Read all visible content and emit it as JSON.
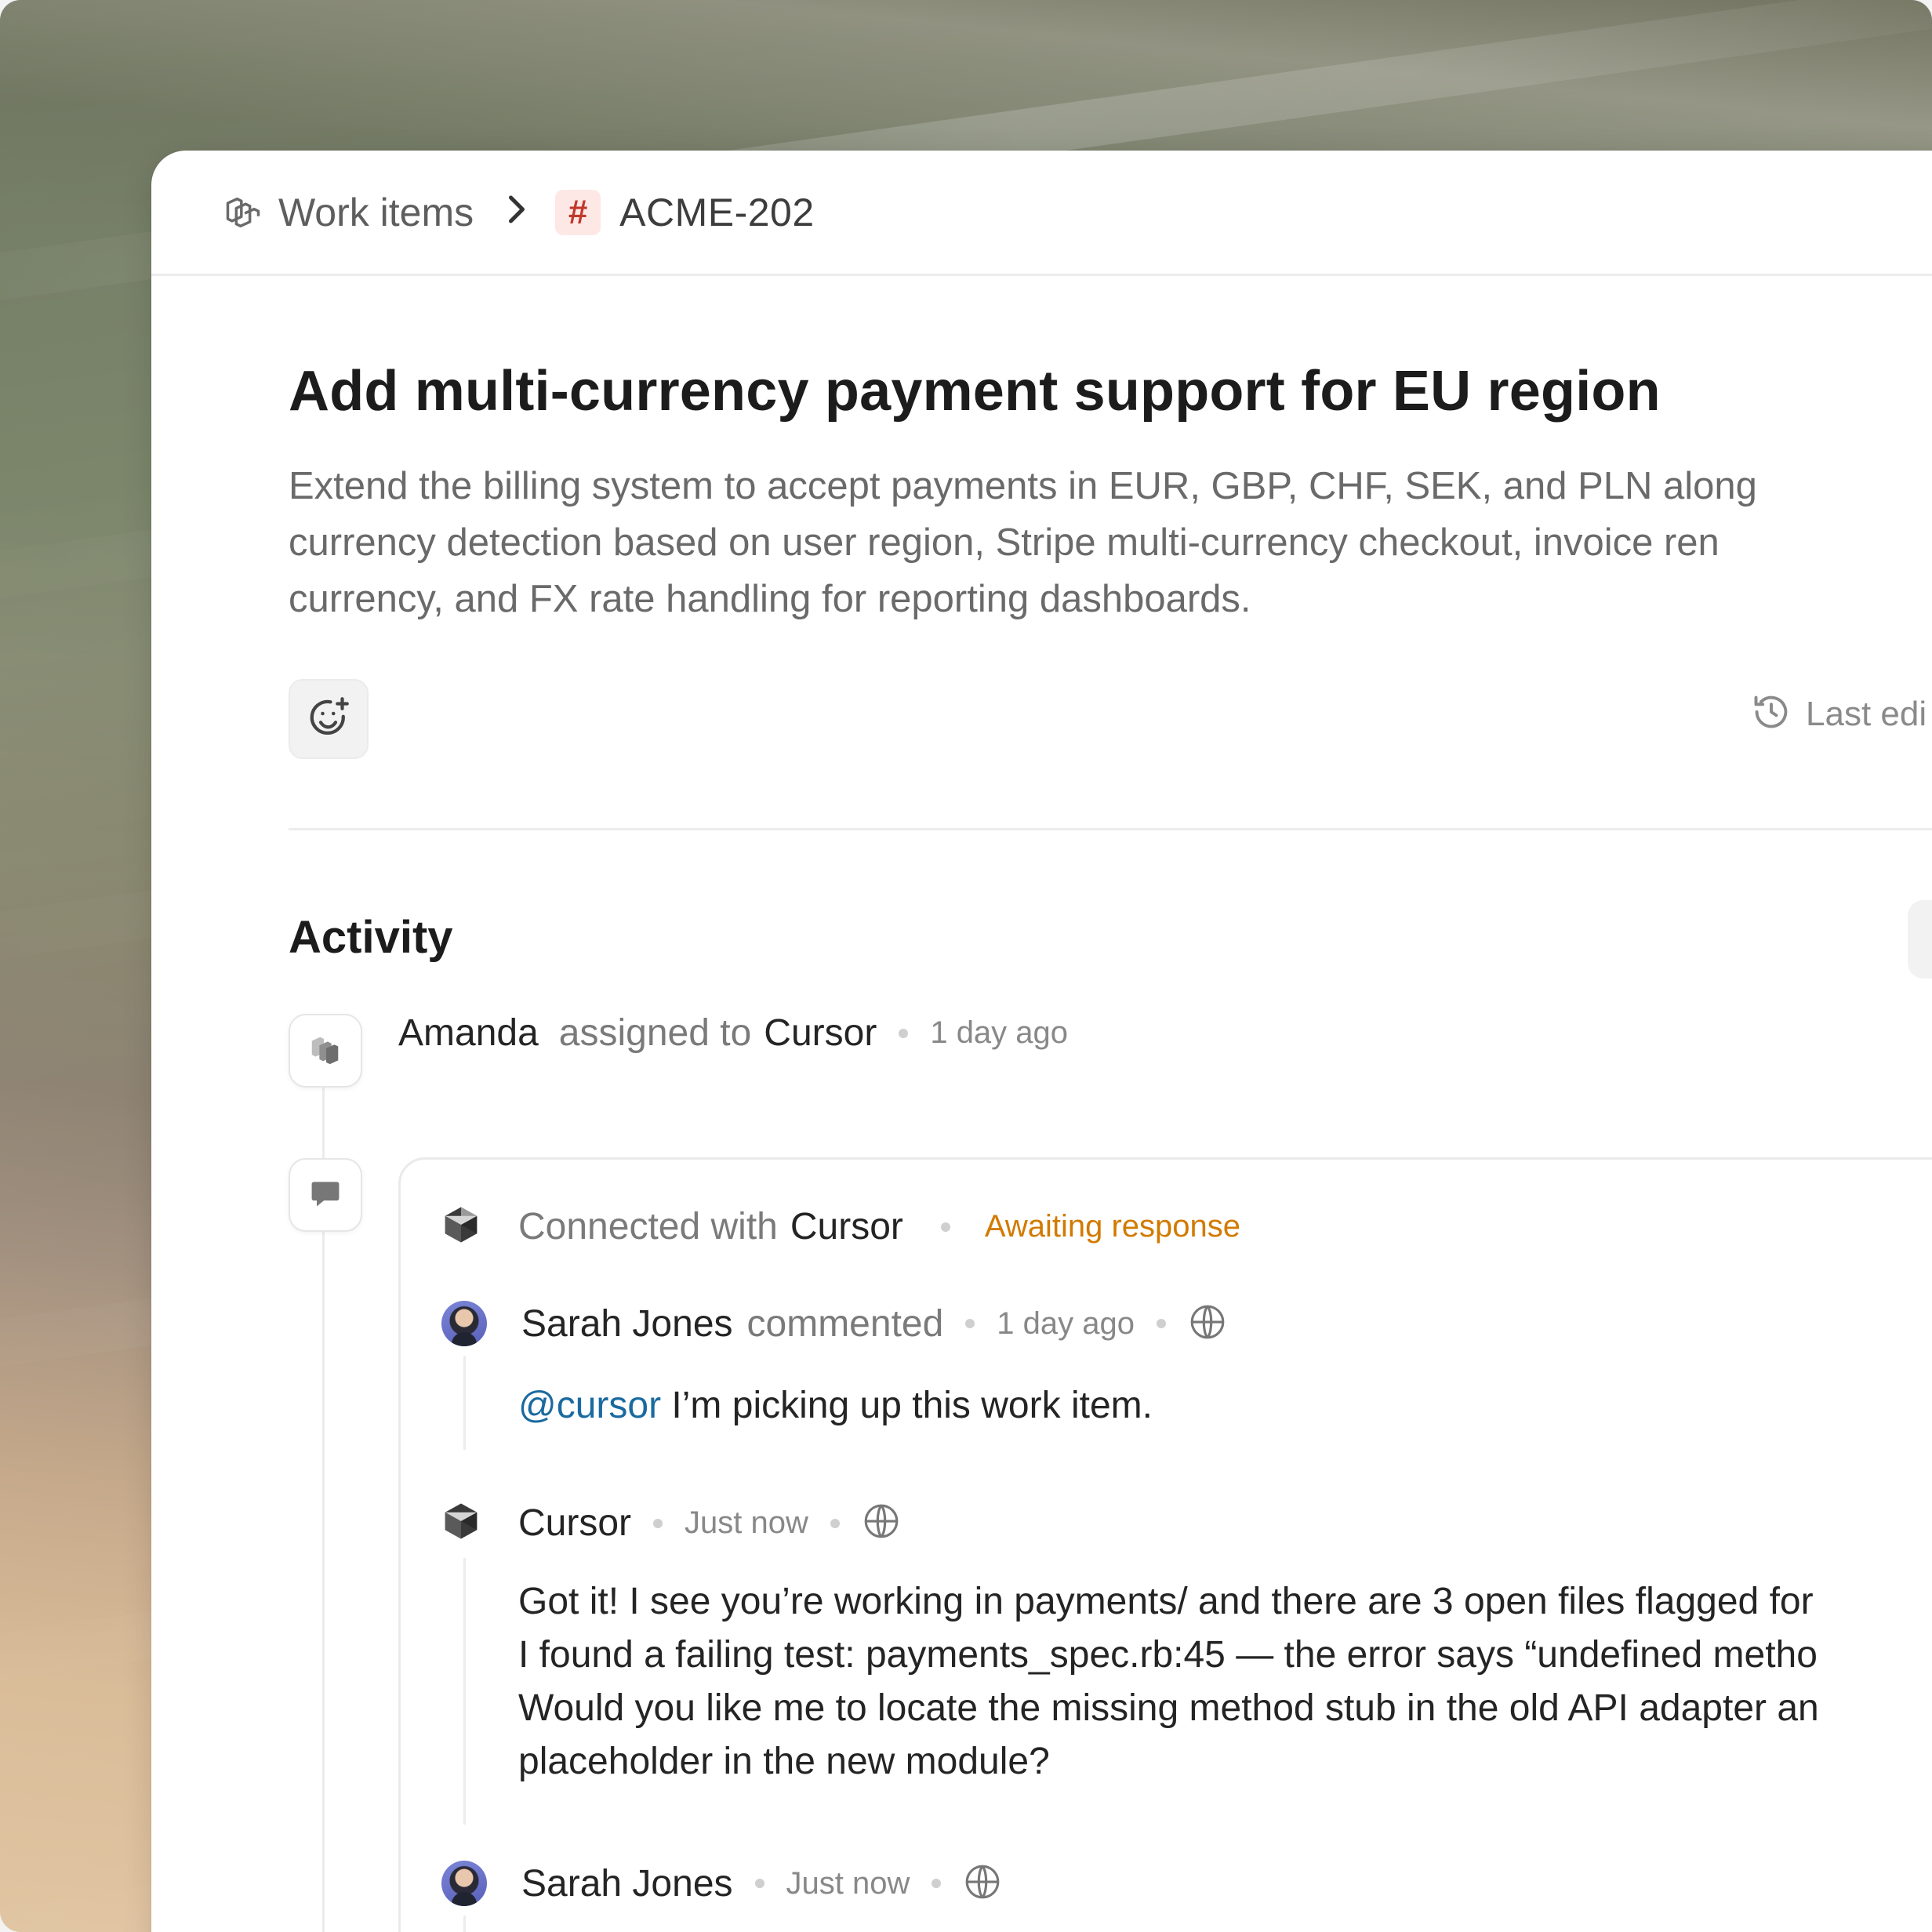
{
  "breadcrumb": {
    "section": "Work items",
    "separator": "›",
    "hash": "#",
    "issue_id": "ACME-202"
  },
  "issue": {
    "title": "Add multi-currency payment support for EU region",
    "description_lines": [
      "Extend the billing system to accept payments in EUR, GBP, CHF, SEK, and PLN along",
      "currency detection based on user region, Stripe multi-currency checkout, invoice ren",
      "currency, and FX rate handling for reporting dashboards."
    ],
    "last_edited": "Last edi"
  },
  "activity": {
    "heading": "Activity",
    "assignment": {
      "actor": "Amanda",
      "action": "assigned to",
      "target": "Cursor",
      "time": "1 day ago"
    },
    "thread": {
      "connected_label": "Connected with",
      "connected_app": "Cursor",
      "status": "Awaiting response",
      "comments": [
        {
          "author": "Sarah Jones",
          "verb": "commented",
          "time": "1 day ago",
          "mention": "@cursor",
          "text": " I’m picking up this work item."
        },
        {
          "author": "Cursor",
          "time": "Just now",
          "lines": [
            "Got it! I see you’re working in payments/ and there are 3 open files flagged for",
            "I found a failing test: payments_spec.rb:45 — the error says “undefined metho",
            "Would you like me to locate the missing method stub in the old API adapter an",
            "placeholder in the new module?"
          ]
        },
        {
          "author": "Sarah Jones",
          "time": "Just now"
        }
      ]
    }
  },
  "colors": {
    "accent_link": "#1a6aa0",
    "status_awaiting": "#d27a00",
    "hash_red": "#c0392b"
  },
  "icons": [
    "stack-icon",
    "chevron-right-icon",
    "hash-icon",
    "add-reaction-icon",
    "history-icon",
    "comment-icon",
    "cursor-logo-icon",
    "globe-icon"
  ]
}
